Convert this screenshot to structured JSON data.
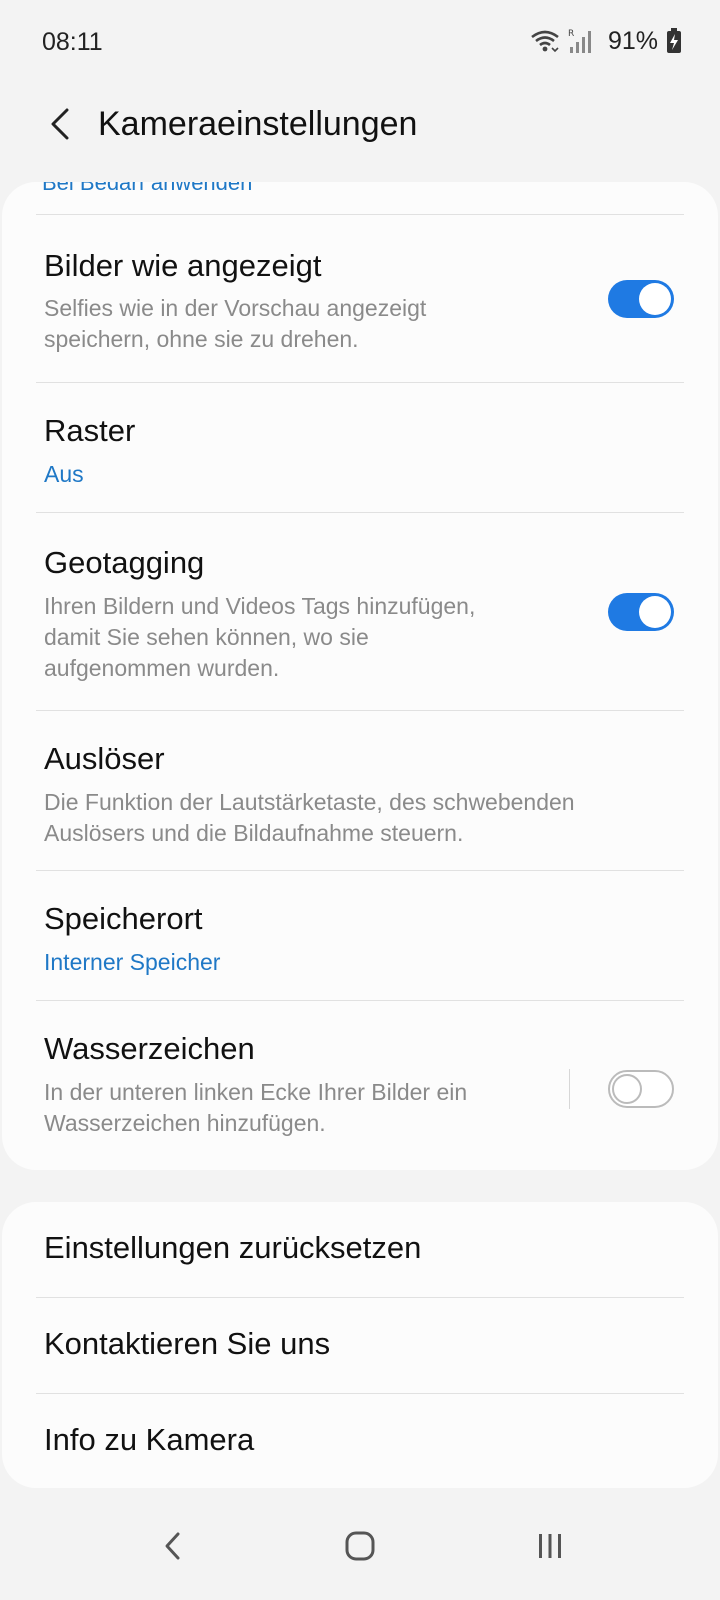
{
  "status_bar": {
    "time": "08:11",
    "battery": "91%",
    "icons": [
      "wifi-icon",
      "signal-icon",
      "battery-charging-icon"
    ]
  },
  "header": {
    "title": "Kameraeinstellungen",
    "back_icon": "back-arrow-icon"
  },
  "settings": {
    "cut_item_label": "Bei Bedarf anwenden",
    "items": [
      {
        "title": "Bilder wie angezeigt",
        "subtitle_lines": [
          "Selfies wie in der Vorschau angezeigt",
          "speichern, ohne sie zu drehen."
        ],
        "toggle": true
      },
      {
        "title": "Raster",
        "value": "Aus"
      },
      {
        "title": "Geotagging",
        "subtitle_lines": [
          "Ihren Bildern und Videos Tags hinzufügen,",
          "damit Sie sehen können, wo sie",
          "aufgenommen wurden."
        ],
        "toggle": true
      },
      {
        "title": "Auslöser",
        "subtitle_lines": [
          "Die Funktion der Lautstärketaste, des schwebenden",
          "Auslösers und die Bildaufnahme steuern."
        ]
      },
      {
        "title": "Speicherort",
        "value": "Interner Speicher"
      },
      {
        "title": "Wasserzeichen",
        "subtitle_lines": [
          "In der unteren linken Ecke Ihrer Bilder ein",
          "Wasserzeichen hinzufügen."
        ],
        "toggle": false
      }
    ]
  },
  "more": {
    "items": [
      "Einstellungen zurücksetzen",
      "Kontaktieren Sie uns",
      "Info zu Kamera"
    ]
  },
  "nav_bar": {
    "icons": [
      "nav-back-icon",
      "nav-home-icon",
      "nav-recents-icon"
    ]
  },
  "colors": {
    "accent": "#1f7ae3",
    "link_blue": "#1f78c6",
    "background": "#f3f3f3",
    "card": "#fcfcfc"
  }
}
